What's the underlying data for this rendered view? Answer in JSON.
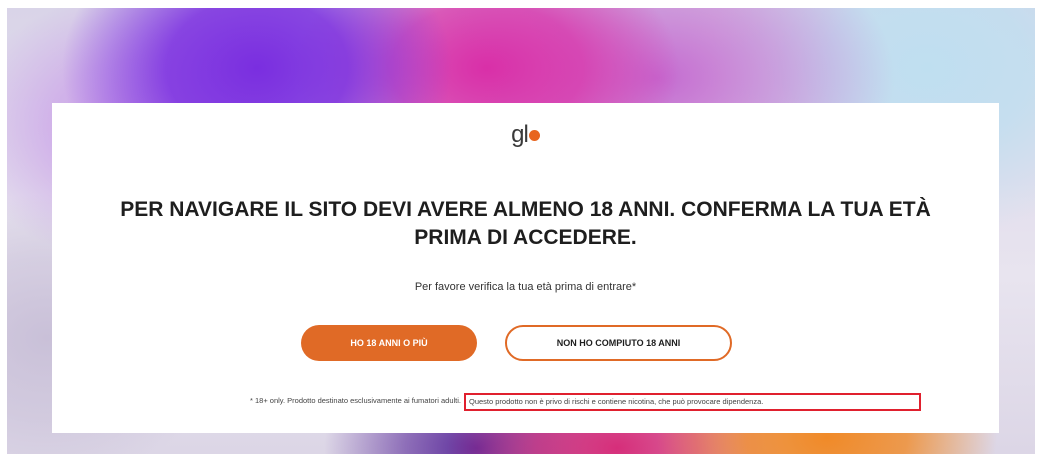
{
  "brand": {
    "logo_text": "gl",
    "accent_color": "#e06a26"
  },
  "gate": {
    "headline": "PER NAVIGARE IL SITO DEVI AVERE ALMENO 18 ANNI. CONFERMA LA TUA ETÀ PRIMA DI ACCEDERE.",
    "subtitle": "Per favore verifica la tua età prima di entrare*",
    "confirm_button": "HO 18 ANNI O PIÙ",
    "deny_button": "NON HO COMPIUTO 18 ANNI",
    "disclaimer_left": "* 18+ only. Prodotto destinato esclusivamente ai fumatori adulti.",
    "disclaimer_highlight": "Questo prodotto non è privo di rischi e contiene nicotina, che può provocare dipendenza.",
    "highlight_color": "#e0202e"
  }
}
